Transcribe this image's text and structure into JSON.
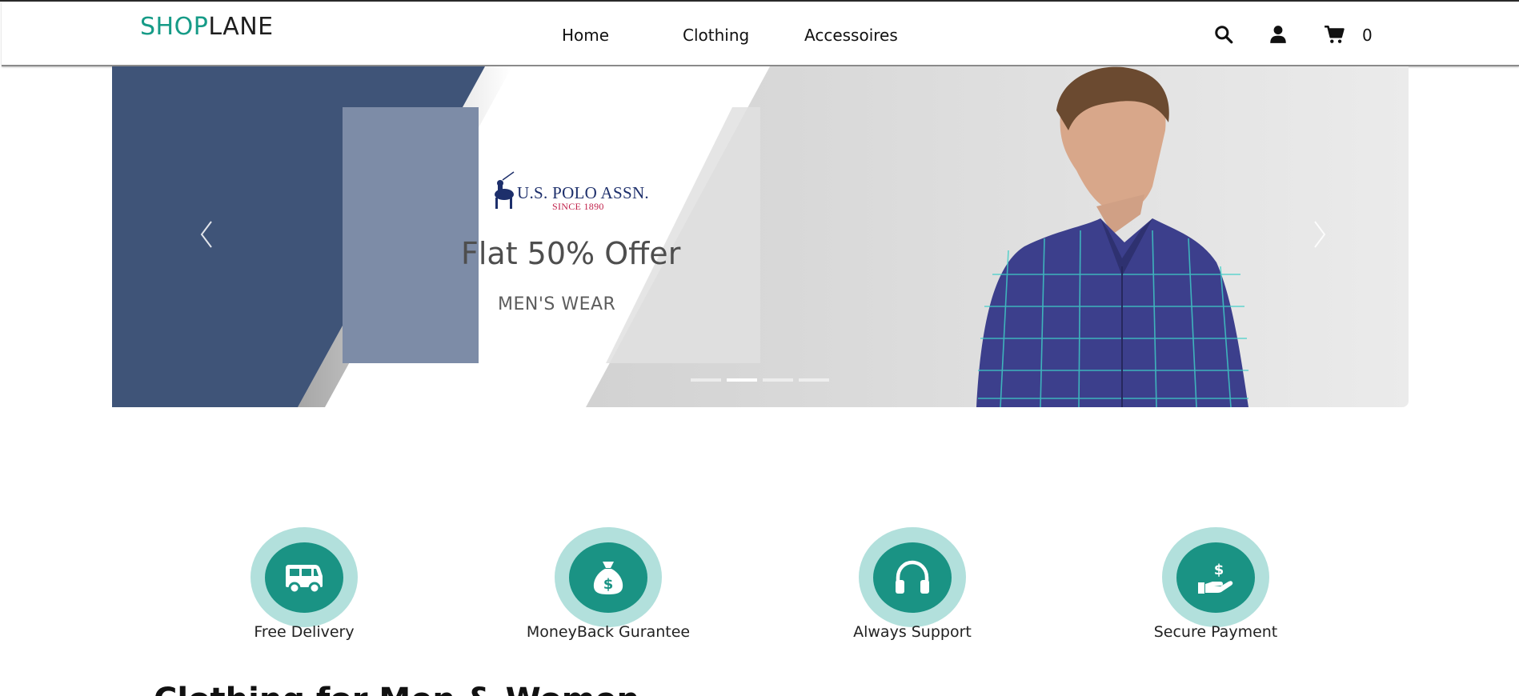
{
  "header": {
    "logo_part1": "SHOP",
    "logo_part2": "LANE",
    "nav": [
      "Home",
      "Clothing",
      "Accessoires"
    ],
    "icons": [
      "search-icon",
      "user-icon",
      "cart-icon"
    ],
    "cart_count": "0"
  },
  "hero": {
    "brand_name": "U.S. POLO ASSN.",
    "brand_since": "SINCE 1890",
    "offer": "Flat 50% Offer",
    "subtitle": "MEN'S WEAR",
    "slide_count": 4,
    "active_slide": 2,
    "colors": {
      "panel": "#3f5478",
      "overlay": "#7d8ca7",
      "light": "#e6e6e6"
    }
  },
  "features": [
    {
      "label": "Free Delivery",
      "icon": "truck-icon"
    },
    {
      "label": "MoneyBack Gurantee",
      "icon": "money-bag-icon"
    },
    {
      "label": "Always Support",
      "icon": "headphones-icon"
    },
    {
      "label": "Secure Payment",
      "icon": "hand-dollar-icon"
    }
  ],
  "section": {
    "title": "Clothing for Men & Women"
  },
  "colors": {
    "accent": "#169b87",
    "feature_ring": "#b2e0dc",
    "feature_core": "#1a9384"
  }
}
